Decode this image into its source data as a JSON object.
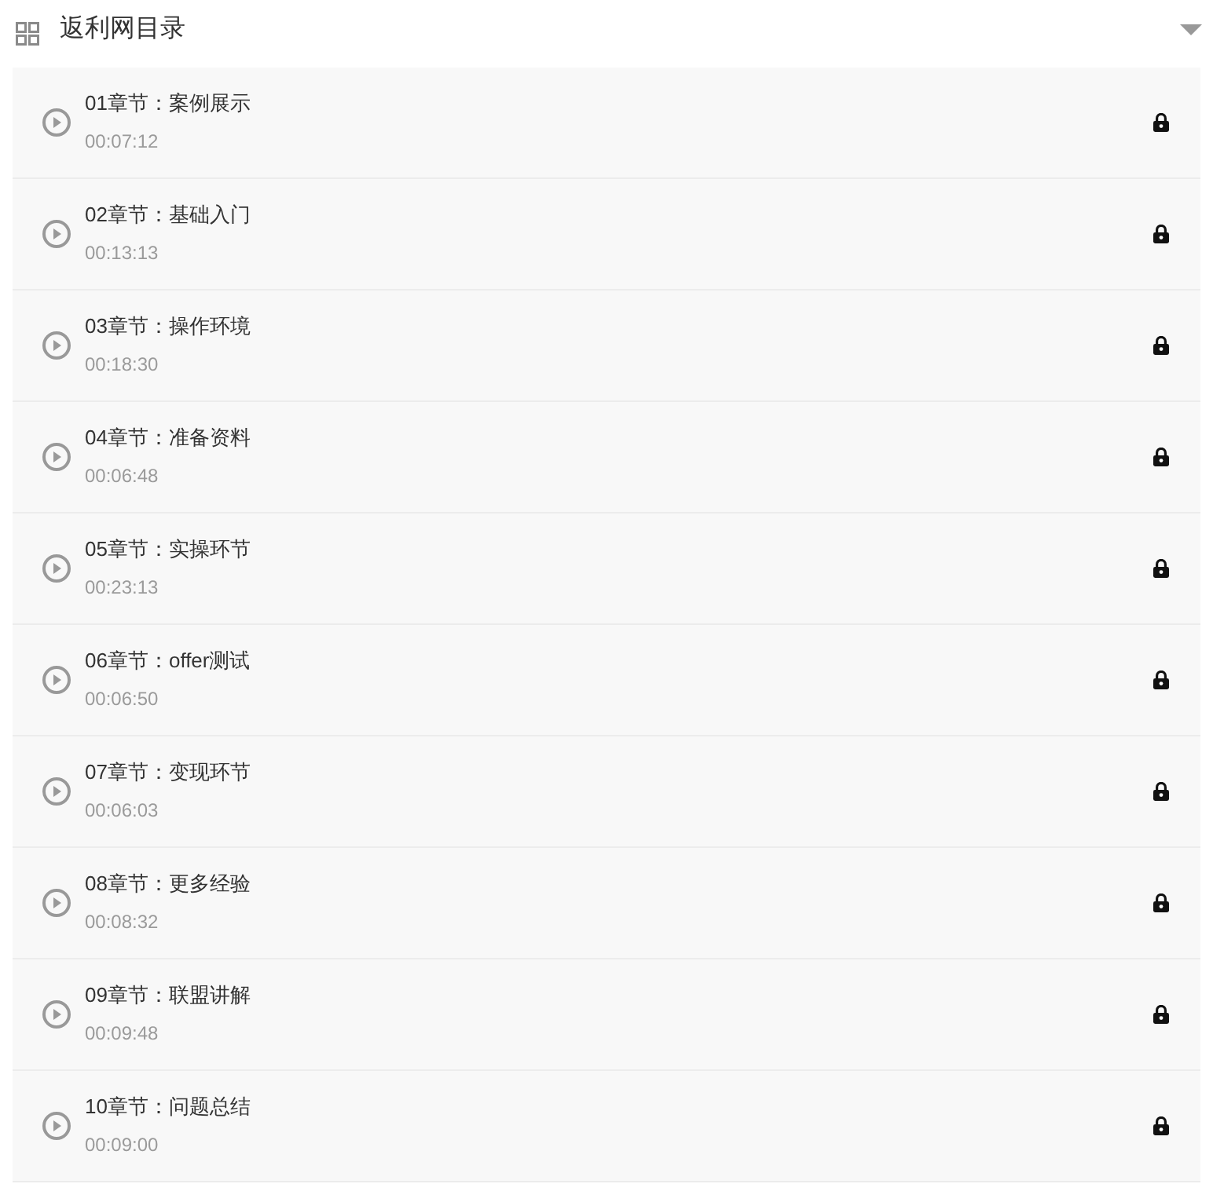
{
  "section": {
    "title": "返利网目录",
    "expanded": true
  },
  "lessons": [
    {
      "title": "01章节：案例展示",
      "duration": "00:07:12",
      "locked": true
    },
    {
      "title": "02章节：基础入门",
      "duration": "00:13:13",
      "locked": true
    },
    {
      "title": "03章节：操作环境",
      "duration": "00:18:30",
      "locked": true
    },
    {
      "title": "04章节：准备资料",
      "duration": "00:06:48",
      "locked": true
    },
    {
      "title": "05章节：实操环节",
      "duration": "00:23:13",
      "locked": true
    },
    {
      "title": "06章节：offer测试",
      "duration": "00:06:50",
      "locked": true
    },
    {
      "title": "07章节：变现环节",
      "duration": "00:06:03",
      "locked": true
    },
    {
      "title": "08章节：更多经验",
      "duration": "00:08:32",
      "locked": true
    },
    {
      "title": "09章节：联盟讲解",
      "duration": "00:09:48",
      "locked": true
    },
    {
      "title": "10章节：问题总结",
      "duration": "00:09:00",
      "locked": true
    }
  ]
}
